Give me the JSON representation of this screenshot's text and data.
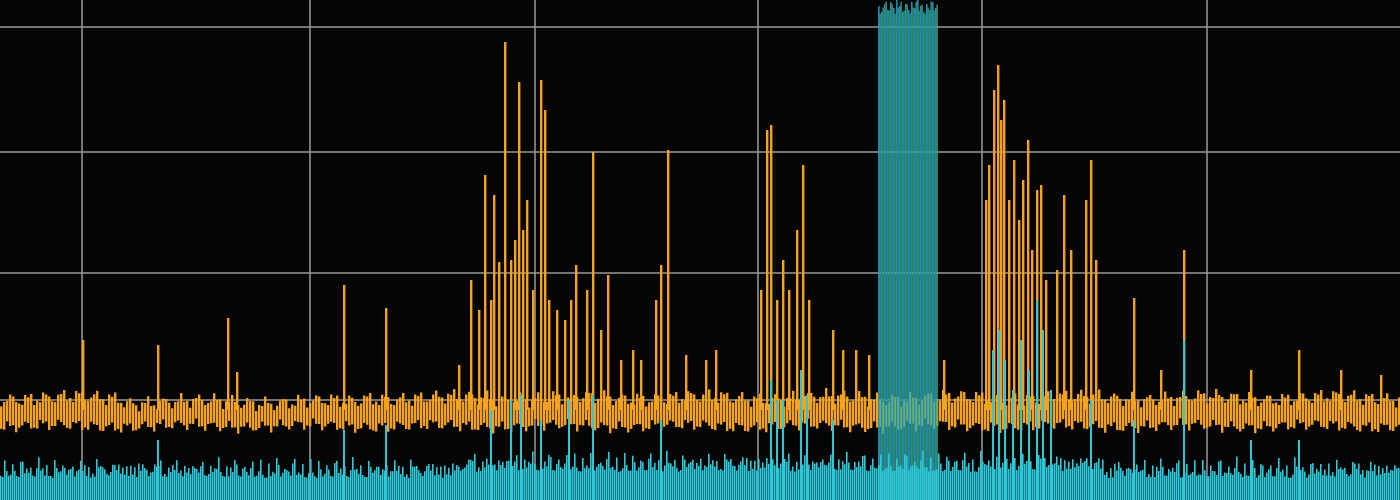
{
  "spectrum_display": {
    "grid_visible": true
  }
}
